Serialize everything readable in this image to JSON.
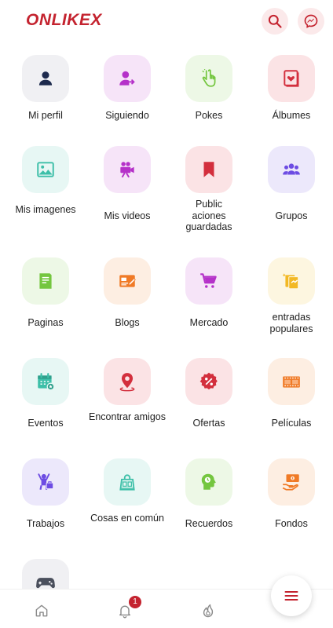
{
  "header": {
    "logo": "ONLIKEX",
    "brand_color": "#c4232f"
  },
  "menu": {
    "items": [
      {
        "label": "Mi perfil",
        "icon": "user-icon",
        "bg": "#f0f0f3",
        "color": "#1d2a4d"
      },
      {
        "label": "Siguiendo",
        "icon": "user-follow-icon",
        "bg": "#f6e4f8",
        "color": "#b531c9"
      },
      {
        "label": "Pokes",
        "icon": "poke-hand-icon",
        "bg": "#edf8e6",
        "color": "#74c63f"
      },
      {
        "label": "Álbumes",
        "icon": "album-icon",
        "bg": "#fbe3e5",
        "color": "#d32f3d"
      },
      {
        "label": "Mis imagenes",
        "icon": "image-icon",
        "bg": "#e7f7f4",
        "color": "#3dbfa8"
      },
      {
        "label": "Mis videos",
        "icon": "video-camera-icon",
        "bg": "#f6e4f8",
        "color": "#b531c9"
      },
      {
        "label": "Public aciones guardadas",
        "icon": "bookmark-icon",
        "bg": "#fbe3e5",
        "color": "#d32f3d"
      },
      {
        "label": "Grupos",
        "icon": "group-icon",
        "bg": "#ece8fb",
        "color": "#6d4ce3"
      },
      {
        "label": "Paginas",
        "icon": "page-icon",
        "bg": "#edf8e6",
        "color": "#74c63f"
      },
      {
        "label": "Blogs",
        "icon": "blog-icon",
        "bg": "#fdeee2",
        "color": "#f07a26"
      },
      {
        "label": "Mercado",
        "icon": "cart-icon",
        "bg": "#f6e4f8",
        "color": "#b531c9"
      },
      {
        "label": "entradas populares",
        "icon": "popular-posts-icon",
        "bg": "#fdf6e0",
        "color": "#f2b824"
      },
      {
        "label": "Eventos",
        "icon": "calendar-icon",
        "bg": "#e7f7f4",
        "color": "#3dbfa8"
      },
      {
        "label": "Encontrar amigos",
        "icon": "location-pin-icon",
        "bg": "#fbe3e5",
        "color": "#d32f3d"
      },
      {
        "label": "Ofertas",
        "icon": "discount-icon",
        "bg": "#fbe3e5",
        "color": "#d32f3d"
      },
      {
        "label": "Películas",
        "icon": "film-icon",
        "bg": "#fdeee2",
        "color": "#f07a26"
      },
      {
        "label": "Trabajos",
        "icon": "jobs-icon",
        "bg": "#ece8fb",
        "color": "#6d4ce3"
      },
      {
        "label": "Cosas en común",
        "icon": "common-things-icon",
        "bg": "#e7f7f4",
        "color": "#3dbfa8"
      },
      {
        "label": "Recuerdos",
        "icon": "memories-head-icon",
        "bg": "#edf8e6",
        "color": "#74c63f"
      },
      {
        "label": "Fondos",
        "icon": "funding-icon",
        "bg": "#fdeee2",
        "color": "#f07a26"
      },
      {
        "label": "",
        "icon": "gamepad-icon",
        "bg": "#f0f0f3",
        "color": "#4a4f5c"
      }
    ]
  },
  "bottom_nav": {
    "notification_count": "1",
    "items": [
      {
        "icon": "home-icon"
      },
      {
        "icon": "bell-icon"
      },
      {
        "icon": "fire-icon"
      },
      {
        "icon": "menu-icon"
      }
    ]
  }
}
